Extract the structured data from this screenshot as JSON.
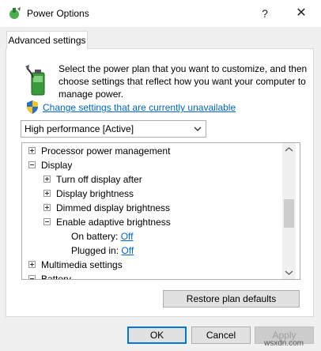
{
  "window": {
    "title": "Power Options",
    "help_label": "?",
    "close_label": "✕"
  },
  "tab": {
    "label": "Advanced settings"
  },
  "intro": {
    "text": "Select the power plan that you want to customize, and then choose settings that reflect how you want your computer to manage power."
  },
  "change_link": {
    "text": "Change settings that are currently unavailable"
  },
  "plan_select": {
    "value": "High performance [Active]"
  },
  "tree": {
    "items": [
      {
        "label": "Processor power management",
        "expander": "plus"
      },
      {
        "label": "Display",
        "expander": "minus"
      },
      {
        "label": "Turn off display after",
        "expander": "plus"
      },
      {
        "label": "Display brightness",
        "expander": "plus"
      },
      {
        "label": "Dimmed display brightness",
        "expander": "plus"
      },
      {
        "label": "Enable adaptive brightness",
        "expander": "minus"
      },
      {
        "label": "On battery:",
        "value": "Off"
      },
      {
        "label": "Plugged in:",
        "value": "Off"
      },
      {
        "label": "Multimedia settings",
        "expander": "plus"
      },
      {
        "label": "Battery",
        "expander": "minus"
      }
    ]
  },
  "buttons": {
    "restore": "Restore plan defaults",
    "ok": "OK",
    "cancel": "Cancel",
    "apply": "Apply"
  },
  "watermark": "wsxdn.com",
  "colors": {
    "link": "#0066cc",
    "focus": "#0078d7"
  }
}
